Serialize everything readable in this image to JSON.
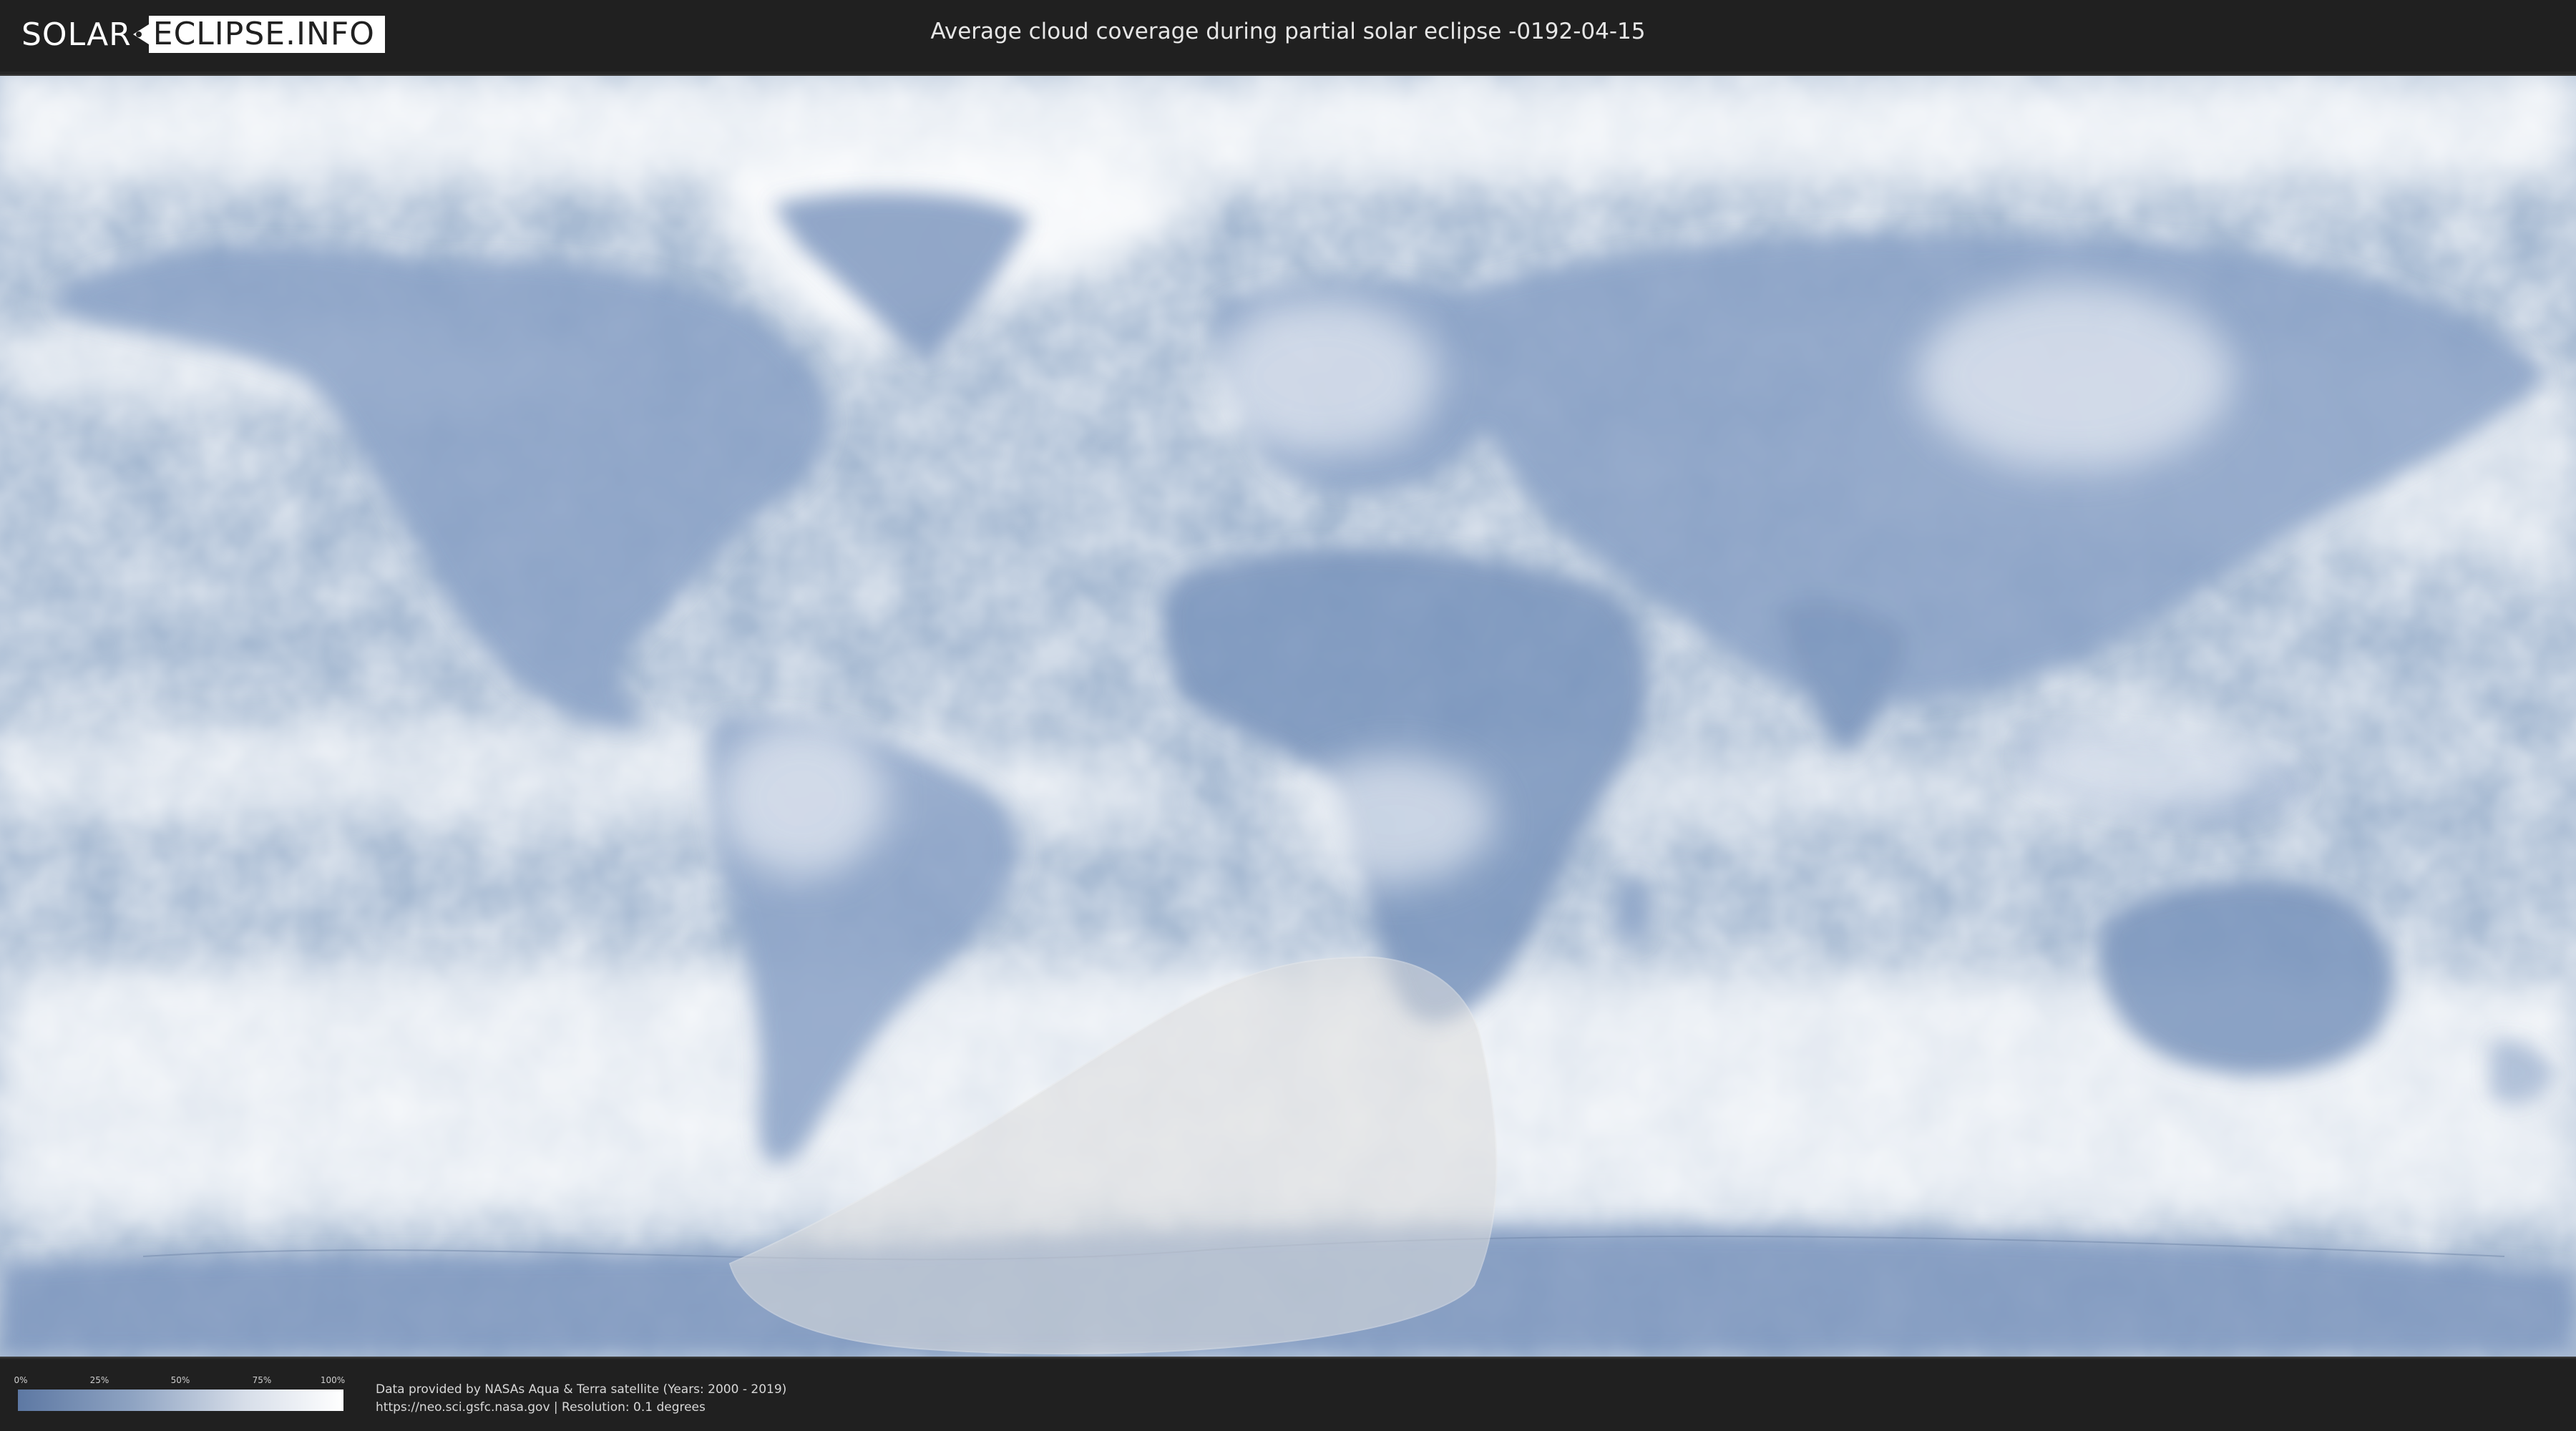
{
  "header": {
    "logo_left": "SOLAR",
    "logo_right": "ECLIPSE.INFO",
    "title": "Average cloud coverage during partial solar eclipse -0192-04-15"
  },
  "map": {
    "ocean_color": "#9fb3cc",
    "cloud_color": "#ffffff",
    "land_color": "#7f98bf",
    "eclipse_zone_color": "#dcdcdc"
  },
  "legend": {
    "ticks": [
      {
        "label": "0%",
        "value": 0
      },
      {
        "label": "25%",
        "value": 25
      },
      {
        "label": "50%",
        "value": 50
      },
      {
        "label": "75%",
        "value": 75
      },
      {
        "label": "100%",
        "value": 100
      }
    ],
    "color_low": "#5d78a3",
    "color_high": "#ffffff"
  },
  "credits": {
    "line1": "Data provided by NASAs Aqua & Terra satellite (Years: 2000 - 2019)",
    "line2": "https://neo.sci.gsfc.nasa.gov | Resolution: 0.1 degrees"
  }
}
